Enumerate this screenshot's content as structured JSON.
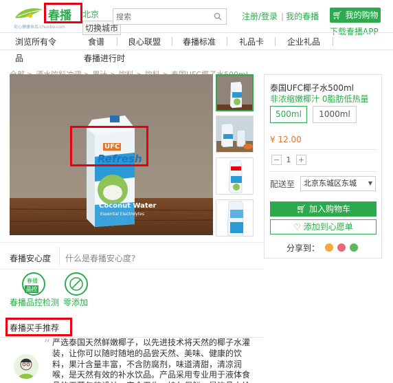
{
  "header": {
    "logo_text": "春播",
    "logo_tagline": "安心健康食品 chunbo.com",
    "city": "北京",
    "switch_city": "切换城市",
    "search_placeholder": "搜索",
    "register_login": "注册/登录",
    "my_chunbo": "我的春播",
    "my_cart": "我的购物",
    "download_app": "下载春播APP"
  },
  "nav": {
    "items": [
      "浏览所有令",
      "食谱",
      "良心联盟",
      "春播标准",
      "礼品卡",
      "企业礼品"
    ],
    "row2": [
      "品",
      "春播进行时"
    ]
  },
  "breadcrumb": "全部 > 酒水饮料冲调 > 果汁 > 饮料 > 饮料 > 泰国UFC椰子水500ml",
  "product": {
    "name": "泰国UFC椰子水500ml",
    "desc": "非浓缩嫩椰汁 0脂肪低热量",
    "specs": [
      "500ml",
      "1000ml"
    ],
    "selected_spec_index": 0,
    "price": "¥ 12.00",
    "quantity_minus": "−",
    "quantity": "1",
    "quantity_plus": "+",
    "ship_label": "配送至",
    "ship_to": "北京东城区东城",
    "add_to_cart": "加入购物车",
    "add_to_wishlist": "添加到心愿单",
    "share_label": "分享到："
  },
  "image_text": {
    "ufc": "UFC",
    "brand": "Refresh",
    "product_line": "Coconut Water",
    "tagline": "Essential Electrolytes"
  },
  "anxin": {
    "title": "春播安心度",
    "question": "什么是春播安心度?",
    "badges": [
      {
        "label": "春播品控检测",
        "badge_top": "春播",
        "badge_bottom": "品控"
      },
      {
        "label": "零添加"
      }
    ]
  },
  "recommend": {
    "title": "春播买手推荐",
    "quote_mark": "“",
    "text": "严选泰国天然鲜嫩椰子，以先进技术将天然的椰子水灌装，让你可以随时随地的品尝天然、美味、健康的饮料，果汁含量丰富，不含防腐剂，味道清甜，清凉润喉，是天然有效的补水饮品。产品采用专业用于液体食品的无菌包装设计，安全卫生，持久保鲜，是饮品中给"
  },
  "colors": {
    "brand_green": "#2eaa4e",
    "price_orange": "#e2742b",
    "highlight_red": "#e60012"
  },
  "icons": [
    "search-icon",
    "cart-icon",
    "heart-icon",
    "weibo-icon",
    "qq-icon",
    "wechat-icon",
    "caret-down-icon"
  ]
}
